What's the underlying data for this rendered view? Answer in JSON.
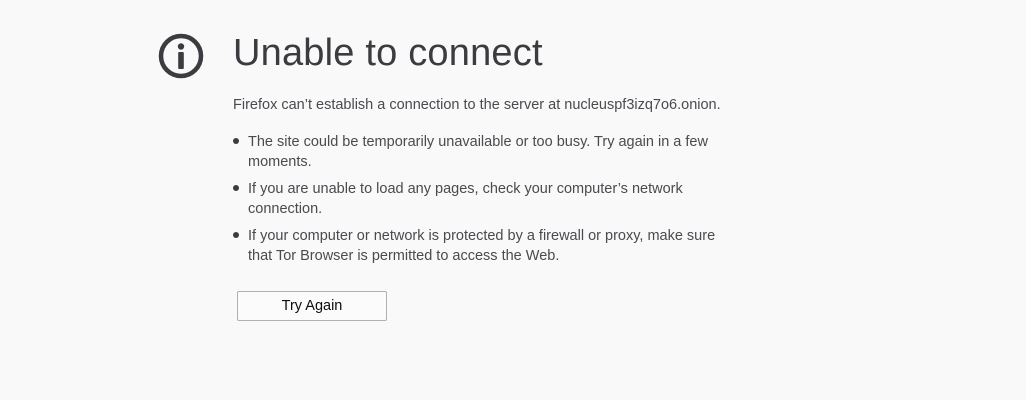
{
  "error": {
    "icon": "info-icon",
    "title": "Unable to connect",
    "description": "Firefox can’t establish a connection to the server at nucleuspf3izq7o6.onion.",
    "tips": [
      "The site could be temporarily unavailable or too busy. Try again in a few moments.",
      "If you are unable to load any pages, check your computer’s network connection.",
      "If your computer or network is protected by a firewall or proxy, make sure that Tor Browser is permitted to access the Web."
    ],
    "try_again_label": "Try Again"
  },
  "colors": {
    "background": "#f9f9fa",
    "icon": "#3b3b40",
    "title": "#3b3b40",
    "text": "#4a4a4f"
  }
}
